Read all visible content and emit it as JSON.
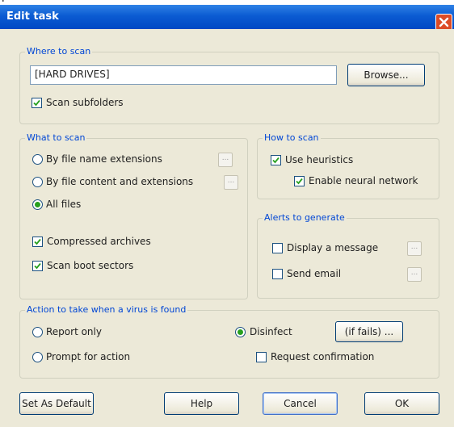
{
  "window": {
    "title": "Edit task",
    "top_char": "l"
  },
  "where_to_scan": {
    "group_label": "Where to scan",
    "path_value": "[HARD DRIVES]",
    "browse_button": "Browse...",
    "scan_subfolders": {
      "label": "Scan subfolders",
      "checked": true
    }
  },
  "what_to_scan": {
    "group_label": "What to scan",
    "options": [
      {
        "label": "By file name extensions",
        "selected": false,
        "has_config": true
      },
      {
        "label": "By file content and extensions",
        "selected": false,
        "has_config": true
      },
      {
        "label": "All files",
        "selected": true,
        "has_config": false
      }
    ],
    "compressed_archives": {
      "label": "Compressed archives",
      "checked": true
    },
    "scan_boot_sectors": {
      "label": "Scan boot sectors",
      "checked": true
    },
    "config_button": "..."
  },
  "how_to_scan": {
    "group_label": "How to scan",
    "use_heuristics": {
      "label": "Use heuristics",
      "checked": true
    },
    "enable_neural_network": {
      "label": "Enable neural network",
      "checked": true
    }
  },
  "alerts": {
    "group_label": "Alerts to generate",
    "display_message": {
      "label": "Display a message",
      "checked": false
    },
    "send_email": {
      "label": "Send email",
      "checked": false
    },
    "config_button": "..."
  },
  "action": {
    "group_label": "Action to take when a virus is found",
    "report_only": {
      "label": "Report only",
      "selected": false
    },
    "prompt_for_action": {
      "label": "Prompt for action",
      "selected": false
    },
    "disinfect": {
      "label": "Disinfect",
      "selected": true
    },
    "if_fails_button": "(if fails) ...",
    "request_confirmation": {
      "label": "Request confirmation",
      "checked": false
    }
  },
  "buttons": {
    "set_as_default": "Set As Default",
    "help": "Help",
    "cancel": "Cancel",
    "ok": "OK"
  },
  "colors": {
    "titlebar": "#0b5bd2",
    "close_button": "#dc4b26",
    "group_label": "#0046d5",
    "dialog_bg": "#ece9d8",
    "radio_dot": "#27a01e",
    "check_mark": "#27a01e"
  }
}
